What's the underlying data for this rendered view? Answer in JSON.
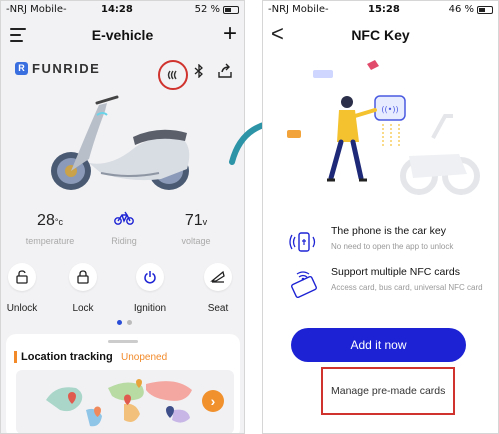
{
  "left_phone": {
    "status": {
      "carrier": "-NRJ Mobile-",
      "time": "14:28",
      "battery": "52 %",
      "battery_level": 0.52
    },
    "header": {
      "title": "E-vehicle",
      "menu_icon": "hamburger-menu-icon",
      "add_icon": "plus-icon"
    },
    "brand": {
      "badge": "R",
      "name": "FUNRIDE"
    },
    "toolbar_icons": [
      "nfc-icon",
      "bluetooth-icon",
      "share-icon"
    ],
    "stats": {
      "temperature": {
        "value": "28",
        "unit": "°c",
        "label": "temperature"
      },
      "riding": {
        "label": "Riding",
        "icon": "bicycle-icon"
      },
      "voltage": {
        "value": "71",
        "unit": "v",
        "label": "voltage"
      }
    },
    "controls": [
      {
        "label": "Unlock",
        "icon": "unlock-icon"
      },
      {
        "label": "Lock",
        "icon": "lock-icon"
      },
      {
        "label": "Ignition",
        "icon": "power-icon"
      },
      {
        "label": "Seat",
        "icon": "seat-icon"
      }
    ],
    "pager": {
      "count": 2,
      "active": 0
    },
    "location_card": {
      "title": "Location tracking",
      "state": "Unopened",
      "go_label": "›"
    }
  },
  "right_phone": {
    "status": {
      "carrier": "-NRJ Mobile-",
      "time": "15:28",
      "battery": "46 %",
      "battery_level": 0.46
    },
    "header": {
      "title": "NFC Key",
      "back_icon": "back-chevron-icon"
    },
    "features": [
      {
        "title": "The phone is the car key",
        "subtitle": "No need to open the app to unlock",
        "icon": "phone-nfc-icon"
      },
      {
        "title": "Support multiple NFC cards",
        "subtitle": "Access card, bus card, universal NFC card",
        "icon": "nfc-card-icon"
      }
    ],
    "add_button": "Add it now",
    "manage_button": "Manage pre-made cards"
  },
  "colors": {
    "accent_blue": "#1d23d4",
    "highlight_red": "#d0332e",
    "orange": "#f28a2a",
    "teal_arrow": "#2d93a6"
  }
}
